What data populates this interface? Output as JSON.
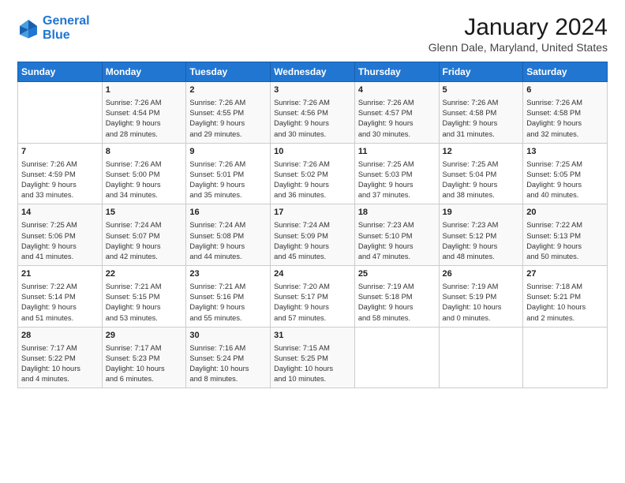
{
  "header": {
    "logo_line1": "General",
    "logo_line2": "Blue",
    "month": "January 2024",
    "location": "Glenn Dale, Maryland, United States"
  },
  "days_of_week": [
    "Sunday",
    "Monday",
    "Tuesday",
    "Wednesday",
    "Thursday",
    "Friday",
    "Saturday"
  ],
  "weeks": [
    [
      {
        "day": "",
        "content": ""
      },
      {
        "day": "1",
        "content": "Sunrise: 7:26 AM\nSunset: 4:54 PM\nDaylight: 9 hours\nand 28 minutes."
      },
      {
        "day": "2",
        "content": "Sunrise: 7:26 AM\nSunset: 4:55 PM\nDaylight: 9 hours\nand 29 minutes."
      },
      {
        "day": "3",
        "content": "Sunrise: 7:26 AM\nSunset: 4:56 PM\nDaylight: 9 hours\nand 30 minutes."
      },
      {
        "day": "4",
        "content": "Sunrise: 7:26 AM\nSunset: 4:57 PM\nDaylight: 9 hours\nand 30 minutes."
      },
      {
        "day": "5",
        "content": "Sunrise: 7:26 AM\nSunset: 4:58 PM\nDaylight: 9 hours\nand 31 minutes."
      },
      {
        "day": "6",
        "content": "Sunrise: 7:26 AM\nSunset: 4:58 PM\nDaylight: 9 hours\nand 32 minutes."
      }
    ],
    [
      {
        "day": "7",
        "content": "Sunrise: 7:26 AM\nSunset: 4:59 PM\nDaylight: 9 hours\nand 33 minutes."
      },
      {
        "day": "8",
        "content": "Sunrise: 7:26 AM\nSunset: 5:00 PM\nDaylight: 9 hours\nand 34 minutes."
      },
      {
        "day": "9",
        "content": "Sunrise: 7:26 AM\nSunset: 5:01 PM\nDaylight: 9 hours\nand 35 minutes."
      },
      {
        "day": "10",
        "content": "Sunrise: 7:26 AM\nSunset: 5:02 PM\nDaylight: 9 hours\nand 36 minutes."
      },
      {
        "day": "11",
        "content": "Sunrise: 7:25 AM\nSunset: 5:03 PM\nDaylight: 9 hours\nand 37 minutes."
      },
      {
        "day": "12",
        "content": "Sunrise: 7:25 AM\nSunset: 5:04 PM\nDaylight: 9 hours\nand 38 minutes."
      },
      {
        "day": "13",
        "content": "Sunrise: 7:25 AM\nSunset: 5:05 PM\nDaylight: 9 hours\nand 40 minutes."
      }
    ],
    [
      {
        "day": "14",
        "content": "Sunrise: 7:25 AM\nSunset: 5:06 PM\nDaylight: 9 hours\nand 41 minutes."
      },
      {
        "day": "15",
        "content": "Sunrise: 7:24 AM\nSunset: 5:07 PM\nDaylight: 9 hours\nand 42 minutes."
      },
      {
        "day": "16",
        "content": "Sunrise: 7:24 AM\nSunset: 5:08 PM\nDaylight: 9 hours\nand 44 minutes."
      },
      {
        "day": "17",
        "content": "Sunrise: 7:24 AM\nSunset: 5:09 PM\nDaylight: 9 hours\nand 45 minutes."
      },
      {
        "day": "18",
        "content": "Sunrise: 7:23 AM\nSunset: 5:10 PM\nDaylight: 9 hours\nand 47 minutes."
      },
      {
        "day": "19",
        "content": "Sunrise: 7:23 AM\nSunset: 5:12 PM\nDaylight: 9 hours\nand 48 minutes."
      },
      {
        "day": "20",
        "content": "Sunrise: 7:22 AM\nSunset: 5:13 PM\nDaylight: 9 hours\nand 50 minutes."
      }
    ],
    [
      {
        "day": "21",
        "content": "Sunrise: 7:22 AM\nSunset: 5:14 PM\nDaylight: 9 hours\nand 51 minutes."
      },
      {
        "day": "22",
        "content": "Sunrise: 7:21 AM\nSunset: 5:15 PM\nDaylight: 9 hours\nand 53 minutes."
      },
      {
        "day": "23",
        "content": "Sunrise: 7:21 AM\nSunset: 5:16 PM\nDaylight: 9 hours\nand 55 minutes."
      },
      {
        "day": "24",
        "content": "Sunrise: 7:20 AM\nSunset: 5:17 PM\nDaylight: 9 hours\nand 57 minutes."
      },
      {
        "day": "25",
        "content": "Sunrise: 7:19 AM\nSunset: 5:18 PM\nDaylight: 9 hours\nand 58 minutes."
      },
      {
        "day": "26",
        "content": "Sunrise: 7:19 AM\nSunset: 5:19 PM\nDaylight: 10 hours\nand 0 minutes."
      },
      {
        "day": "27",
        "content": "Sunrise: 7:18 AM\nSunset: 5:21 PM\nDaylight: 10 hours\nand 2 minutes."
      }
    ],
    [
      {
        "day": "28",
        "content": "Sunrise: 7:17 AM\nSunset: 5:22 PM\nDaylight: 10 hours\nand 4 minutes."
      },
      {
        "day": "29",
        "content": "Sunrise: 7:17 AM\nSunset: 5:23 PM\nDaylight: 10 hours\nand 6 minutes."
      },
      {
        "day": "30",
        "content": "Sunrise: 7:16 AM\nSunset: 5:24 PM\nDaylight: 10 hours\nand 8 minutes."
      },
      {
        "day": "31",
        "content": "Sunrise: 7:15 AM\nSunset: 5:25 PM\nDaylight: 10 hours\nand 10 minutes."
      },
      {
        "day": "",
        "content": ""
      },
      {
        "day": "",
        "content": ""
      },
      {
        "day": "",
        "content": ""
      }
    ]
  ]
}
